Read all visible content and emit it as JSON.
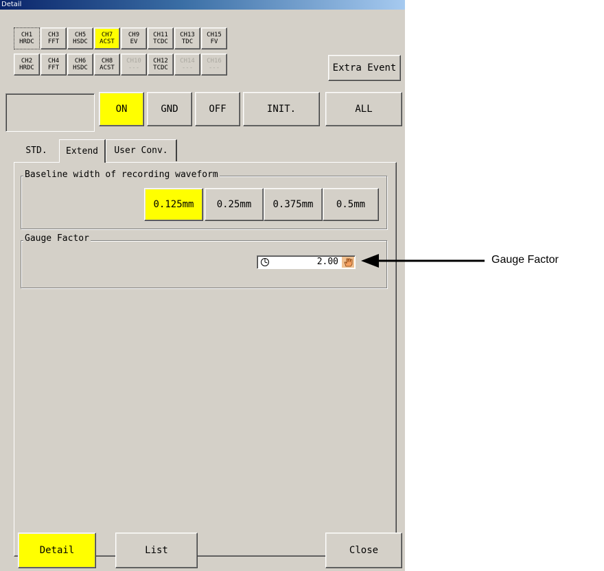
{
  "window": {
    "title": "Detail"
  },
  "channels": {
    "row1": [
      {
        "ch": "CH1",
        "type": "HRDC",
        "state": "selected"
      },
      {
        "ch": "CH3",
        "type": "FFT",
        "state": "normal"
      },
      {
        "ch": "CH5",
        "type": "HSDC",
        "state": "normal"
      },
      {
        "ch": "CH7",
        "type": "ACST",
        "state": "active"
      },
      {
        "ch": "CH9",
        "type": "EV",
        "state": "normal"
      },
      {
        "ch": "CH11",
        "type": "TCDC",
        "state": "normal"
      },
      {
        "ch": "CH13",
        "type": "TDC",
        "state": "normal"
      },
      {
        "ch": "CH15",
        "type": "FV",
        "state": "normal"
      }
    ],
    "row2": [
      {
        "ch": "CH2",
        "type": "HRDC",
        "state": "normal"
      },
      {
        "ch": "CH4",
        "type": "FFT",
        "state": "normal"
      },
      {
        "ch": "CH6",
        "type": "HSDC",
        "state": "normal"
      },
      {
        "ch": "CH8",
        "type": "ACST",
        "state": "normal"
      },
      {
        "ch": "CH10",
        "type": "---",
        "state": "disabled"
      },
      {
        "ch": "CH12",
        "type": "TCDC",
        "state": "normal"
      },
      {
        "ch": "CH14",
        "type": "---",
        "state": "disabled"
      },
      {
        "ch": "CH16",
        "type": "---",
        "state": "disabled"
      }
    ]
  },
  "extra_event_label": "Extra Event",
  "controls": {
    "on": "ON",
    "gnd": "GND",
    "off": "OFF",
    "init": "INIT.",
    "all": "ALL"
  },
  "tabs": [
    {
      "label": "STD."
    },
    {
      "label": "Extend"
    },
    {
      "label": "User Conv."
    }
  ],
  "active_tab": "Extend",
  "baseline": {
    "label": "Baseline width of recording waveform",
    "options": [
      "0.125mm",
      "0.25mm",
      "0.375mm",
      "0.5mm"
    ],
    "selected": "0.125mm"
  },
  "gauge": {
    "label": "Gauge Factor",
    "value": "2.00"
  },
  "footer": {
    "detail": "Detail",
    "list": "List",
    "close": "Close"
  },
  "annotation": {
    "label": "Gauge Factor"
  },
  "colors": {
    "active": "#ffff00",
    "face": "#d4d0c8"
  }
}
